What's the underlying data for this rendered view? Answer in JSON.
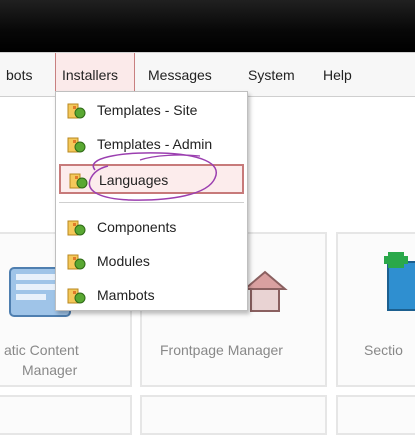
{
  "menu": {
    "items": [
      {
        "label": "bots"
      },
      {
        "label": "Installers"
      },
      {
        "label": "Messages"
      },
      {
        "label": "System"
      },
      {
        "label": "Help"
      }
    ]
  },
  "dropdown": {
    "items": [
      {
        "label": "Templates - Site",
        "icon": "installer-icon"
      },
      {
        "label": "Templates - Admin",
        "icon": "installer-icon"
      },
      {
        "label": "Languages",
        "icon": "installer-icon",
        "highlighted": true
      },
      {
        "label": "Components",
        "icon": "installer-icon"
      },
      {
        "label": "Modules",
        "icon": "installer-icon"
      },
      {
        "label": "Mambots",
        "icon": "installer-icon"
      }
    ]
  },
  "panels": {
    "content_line1": "atic Content",
    "content_line2": "Manager",
    "frontpage": "Frontpage Manager",
    "section": "Sectio"
  },
  "colors": {
    "accent_highlight": "#c77a7a",
    "annotation": "#9b3fb0"
  }
}
